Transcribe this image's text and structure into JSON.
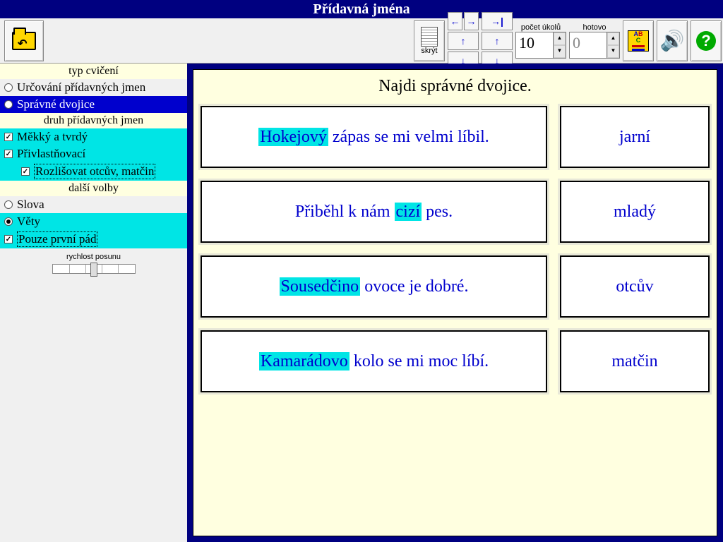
{
  "title": "Přídavná jména",
  "toolbar": {
    "hide_label": "skrýt",
    "tasks_label": "počet úkolů",
    "tasks_value": "10",
    "done_label": "hotovo",
    "done_value": "0"
  },
  "sidebar": {
    "sec1": "typ cvičení",
    "opt1a": "Určování přídavných jmen",
    "opt1b": "Správné dvojice",
    "sec2": "druh přídavných jmen",
    "opt2a": "Měkký a tvrdý",
    "opt2b": "Přivlastňovací",
    "opt2c": "Rozlišovat otcův, matčin",
    "sec3": "další volby",
    "opt3a": "Slova",
    "opt3b": "Věty",
    "opt3c": "Pouze první pád",
    "speed": "rychlost posunu"
  },
  "instruction": "Najdi správné dvojice.",
  "rows": [
    {
      "hl": "Hokejový",
      "rest": " zápas se mi velmi líbil.",
      "pre": "",
      "right": "jarní"
    },
    {
      "pre": "Přiběhl k nám ",
      "hl": "cizí",
      "rest": " pes.",
      "right": "mladý"
    },
    {
      "pre": "",
      "hl": "Sousedčino",
      "rest": " ovoce je dobré.",
      "right": "otcův"
    },
    {
      "pre": "",
      "hl": "Kamarádovo",
      "rest": " kolo se mi moc líbí.",
      "right": "matčin"
    }
  ]
}
